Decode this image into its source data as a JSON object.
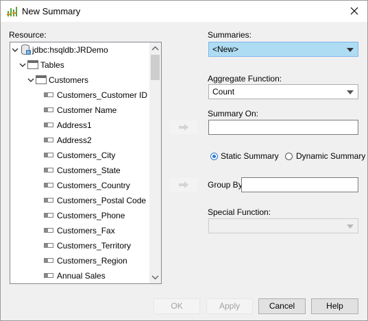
{
  "window": {
    "title": "New Summary"
  },
  "labels": {
    "resource": "Resource:",
    "summaries": "Summaries:",
    "aggregate": "Aggregate Function:",
    "summary_on": "Summary On:",
    "group_by": "Group By",
    "special": "Special Function:"
  },
  "tree": {
    "db": "jdbc:hsqldb:JRDemo",
    "tables": "Tables",
    "table": "Customers",
    "fields": [
      "Customers_Customer ID",
      "Customer Name",
      "Address1",
      "Address2",
      "Customers_City",
      "Customers_State",
      "Customers_Country",
      "Customers_Postal Code",
      "Customers_Phone",
      "Customers_Fax",
      "Customers_Territory",
      "Customers_Region",
      "Annual Sales"
    ]
  },
  "summaries_value": "<New>",
  "aggregate_value": "Count",
  "summary_on_value": "",
  "group_by_value": "",
  "special_value": "",
  "radio": {
    "static": "Static Summary",
    "dynamic": "Dynamic Summary",
    "selected": "static"
  },
  "buttons": {
    "ok": "OK",
    "apply": "Apply",
    "cancel": "Cancel",
    "help": "Help"
  },
  "colors": {
    "selected_combo": "#aedcf2",
    "accent": "#2a7ad0"
  },
  "icons": {
    "title": "summary-chart-icon",
    "close": "close-icon",
    "db": "database-icon",
    "table": "table-icon",
    "field": "field-icon",
    "move": "right-arrow-icon"
  }
}
